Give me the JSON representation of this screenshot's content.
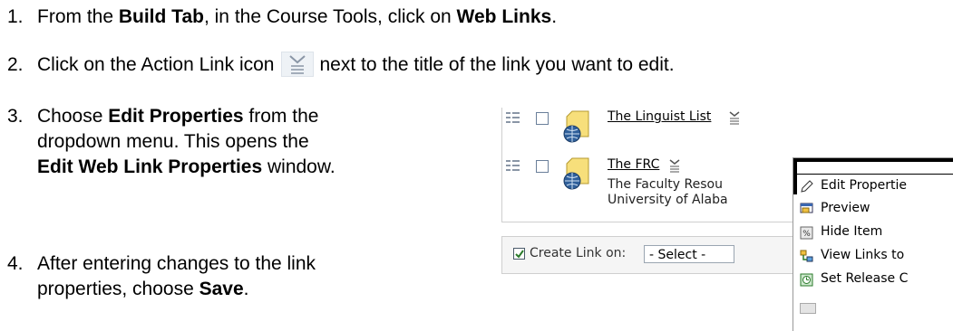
{
  "steps": [
    {
      "num": "1.",
      "a": "From the ",
      "b1": "Build Tab",
      "c": ", in the Course Tools, click on ",
      "b2": "Web Links",
      "d": "."
    },
    {
      "num": "2.",
      "a": "Click on the Action Link icon",
      "d": "next to the title of the link you want to edit."
    },
    {
      "num": "3.",
      "a": "Choose ",
      "b1": "Edit Properties",
      "c": " from the",
      "line2": "dropdown menu. This opens the",
      "b2": "Edit Web Link Properties",
      "d": " window."
    },
    {
      "num": "4.",
      "a": "After entering changes to the link",
      "line2": "properties, choose ",
      "b1": "Save",
      "d": "."
    }
  ],
  "screenshot": {
    "links": [
      {
        "title": "The Linguist List"
      },
      {
        "title": "The FRC",
        "desc_line1": "The Faculty Resou",
        "desc_line2": "University of Alaba"
      }
    ],
    "create_label": "Create Link on:",
    "select_value": "- Select -",
    "menu": [
      {
        "label": "Edit Propertie",
        "icon": "pencil-icon"
      },
      {
        "label": "Preview",
        "icon": "preview-icon"
      },
      {
        "label": "Hide Item",
        "icon": "hide-icon"
      },
      {
        "label": "View Links to",
        "icon": "view-links-icon"
      },
      {
        "label": "Set Release C",
        "icon": "release-icon"
      }
    ]
  }
}
